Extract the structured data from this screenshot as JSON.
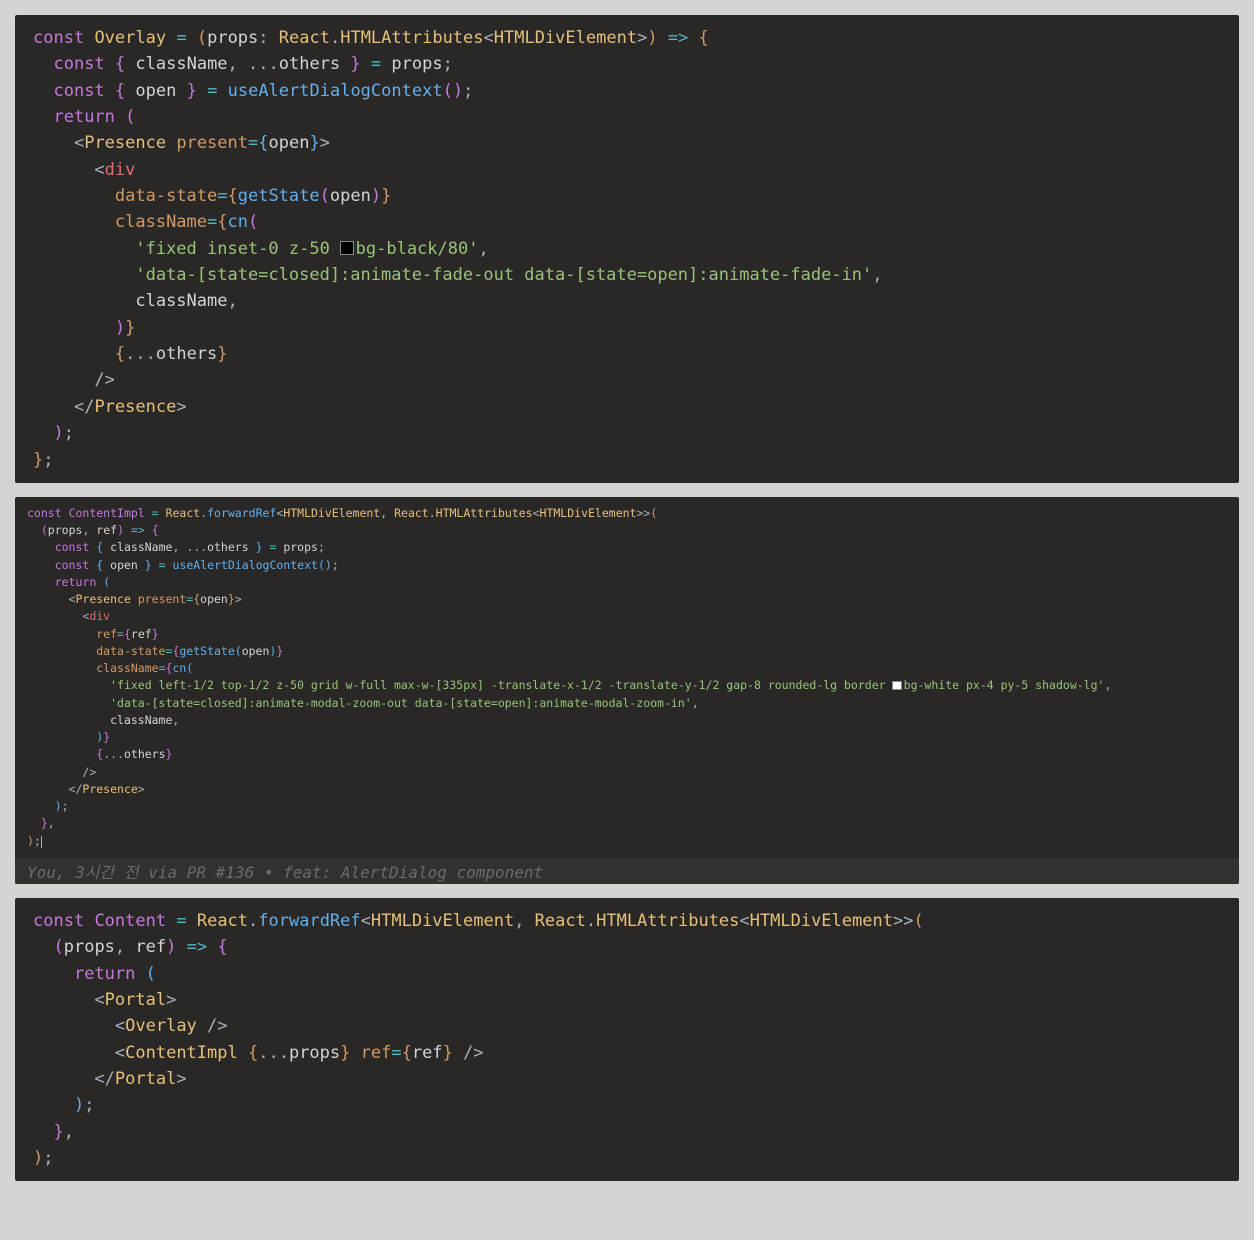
{
  "block1": {
    "l1": {
      "const": "const",
      "name": "Overlay",
      "eq": "=",
      "lp": "(",
      "props": "props",
      "col": ":",
      "react": "React",
      "dot": ".",
      "htmlattr": "HTMLAttributes",
      "lt": "<",
      "divel": "HTMLDivElement",
      "gt": ">",
      "rp": ")",
      "arrow": "=>",
      "lb": "{"
    },
    "l2": {
      "const": "const",
      "lb": "{",
      "className": "className",
      "sep": ", ...",
      "others": "others",
      "rb": "}",
      "eq": "=",
      "props": "props",
      "sc": ";"
    },
    "l3": {
      "const": "const",
      "lb": "{",
      "open": "open",
      "rb": "}",
      "eq": "=",
      "call": "useAlertDialogContext",
      "lp": "(",
      "rp": ")",
      "sc": ";"
    },
    "l4": {
      "return": "return",
      "lp": "("
    },
    "l5": {
      "lt": "<",
      "tag": "Presence",
      "attr": "present",
      "eq": "=",
      "lb": "{",
      "open": "open",
      "rb": "}",
      "gt": ">"
    },
    "l6": {
      "lt": "<",
      "tag": "div"
    },
    "l7": {
      "attr": "data-state",
      "eq": "=",
      "lb": "{",
      "call": "getState",
      "lp": "(",
      "arg": "open",
      "rp": ")",
      "rb": "}"
    },
    "l8": {
      "attr": "className",
      "eq": "=",
      "lb": "{",
      "call": "cn",
      "lp": "("
    },
    "l9": {
      "str": "'fixed inset-0 z-50 ",
      "str2": "bg-black/80'",
      "sep": ","
    },
    "l10": {
      "str": "'data-[state=closed]:animate-fade-out data-[state=open]:animate-fade-in'",
      "sep": ","
    },
    "l11": {
      "ident": "className",
      "sep": ","
    },
    "l12": {
      "rp": ")",
      "rb": "}"
    },
    "l13": {
      "lb": "{",
      "spread": "...",
      "ident": "others",
      "rb": "}"
    },
    "l14": {
      "close": "/>"
    },
    "l15": {
      "lt": "</",
      "tag": "Presence",
      "gt": ">"
    },
    "l16": {
      "rp": ")",
      "sc": ";"
    },
    "l17": {
      "rb": "}",
      "sc": ";"
    }
  },
  "block2": {
    "l1": {
      "const": "const",
      "name": "ContentImpl",
      "eq": "=",
      "react": "React",
      "dot": ".",
      "fwd": "forwardRef",
      "lt": "<",
      "t1": "HTMLDivElement",
      "sep": ", ",
      "react2": "React",
      "dot2": ".",
      "ha": "HTMLAttributes",
      "lt2": "<",
      "t2": "HTMLDivElement",
      "gt2": ">>",
      "lp": "("
    },
    "l2": {
      "lp": "(",
      "props": "props",
      "sep": ", ",
      "ref": "ref",
      "rp": ")",
      "arrow": "=>",
      "lb": "{"
    },
    "l3": {
      "const": "const",
      "lb": "{",
      "cn": "className",
      "sep": ", ...",
      "ot": "others",
      "rb": "}",
      "eq": "=",
      "props": "props",
      "sc": ";"
    },
    "l4": {
      "const": "const",
      "lb": "{",
      "open": "open",
      "rb": "}",
      "eq": "=",
      "call": "useAlertDialogContext",
      "lp": "(",
      "rp": ")",
      "sc": ";"
    },
    "l5": {
      "return": "return",
      "lp": "("
    },
    "l6": {
      "lt": "<",
      "tag": "Presence",
      "attr": "present",
      "eq": "=",
      "lb": "{",
      "open": "open",
      "rb": "}",
      "gt": ">"
    },
    "l7": {
      "lt": "<",
      "tag": "div"
    },
    "l8": {
      "attr": "ref",
      "eq": "=",
      "lb": "{",
      "id": "ref",
      "rb": "}"
    },
    "l9": {
      "attr": "data-state",
      "eq": "=",
      "lb": "{",
      "call": "getState",
      "lp": "(",
      "arg": "open",
      "rp": ")",
      "rb": "}"
    },
    "l10": {
      "attr": "className",
      "eq": "=",
      "lb": "{",
      "call": "cn",
      "lp": "("
    },
    "l11": {
      "str": "'fixed left-1/2 top-1/2 z-50 grid w-full max-w-[335px] -translate-x-1/2 -translate-y-1/2 gap-8 rounded-lg border ",
      "str2": "bg-white px-4 py-5 shadow-lg'",
      "sep": ","
    },
    "l12": {
      "str": "'data-[state=closed]:animate-modal-zoom-out data-[state=open]:animate-modal-zoom-in'",
      "sep": ","
    },
    "l13": {
      "id": "className",
      "sep": ","
    },
    "l14": {
      "rp": ")",
      "rb": "}"
    },
    "l15": {
      "lb": "{",
      "spread": "...",
      "id": "others",
      "rb": "}"
    },
    "l16": {
      "close": "/>"
    },
    "l17": {
      "lt": "</",
      "tag": "Presence",
      "gt": ">"
    },
    "l18": {
      "rp": ")",
      "sc": ";"
    },
    "l19": {
      "rb": "}",
      "sep": ","
    },
    "l20": {
      "rp": ")",
      "sc": ";"
    },
    "blame": "You, 3시간 전 via PR #136 • feat: AlertDialog component"
  },
  "block3": {
    "l1": {
      "const": "const",
      "name": "Content",
      "eq": "=",
      "react": "React",
      "dot": ".",
      "fwd": "forwardRef",
      "lt": "<",
      "t1": "HTMLDivElement",
      "sep": ", ",
      "react2": "React",
      "dot2": ".",
      "ha": "HTMLAttributes",
      "lt2": "<",
      "t2": "HTMLDivElement",
      "gt2": ">>",
      "lp": "("
    },
    "l2": {
      "lp": "(",
      "props": "props",
      "sep": ", ",
      "ref": "ref",
      "rp": ")",
      "arrow": "=>",
      "lb": "{"
    },
    "l3": {
      "return": "return",
      "lp": "("
    },
    "l4": {
      "lt": "<",
      "tag": "Portal",
      "gt": ">"
    },
    "l5": {
      "lt": "<",
      "tag": "Overlay",
      "close": " />"
    },
    "l6": {
      "lt": "<",
      "tag": "ContentImpl",
      "sp": " ",
      "lb": "{",
      "spread": "...",
      "props": "props",
      "rb": "}",
      "sp2": " ",
      "attr": "ref",
      "eq": "=",
      "lb2": "{",
      "ref": "ref",
      "rb2": "}",
      "close": " />"
    },
    "l7": {
      "lt": "</",
      "tag": "Portal",
      "gt": ">"
    },
    "l8": {
      "rp": ")",
      "sc": ";"
    },
    "l9": {
      "rb": "}",
      "sep": ","
    },
    "l10": {
      "rp": ")",
      "sc": ";"
    }
  }
}
